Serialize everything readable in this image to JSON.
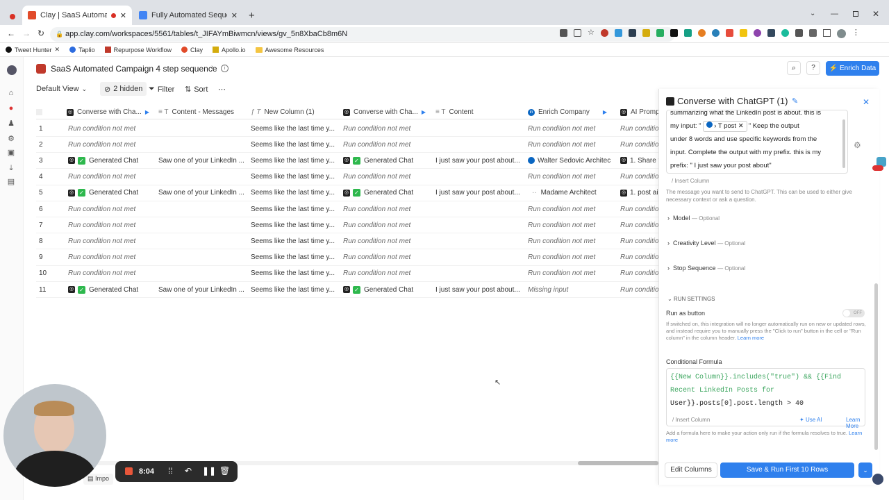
{
  "browser": {
    "tabs": [
      {
        "title": "Clay | SaaS Automated Camp"
      },
      {
        "title": "Fully Automated Sequences SaaS"
      }
    ],
    "url": "app.clay.com/workspaces/5561/tables/t_JIFAYmBiwmcn/views/gv_5n8XbaCb8m6N",
    "bookmarks": [
      "Tweet Hunter",
      "Taplio",
      "Repurpose Workflow",
      "Clay",
      "Apollo.io",
      "Awesome Resources"
    ]
  },
  "header": {
    "title": "SaaS Automated Campaign 4 step sequence",
    "enrich_label": "Enrich Data"
  },
  "toolbar": {
    "view": "Default View",
    "hidden": "2 hidden",
    "filter": "Filter",
    "sort": "Sort"
  },
  "columns": [
    "Converse with Cha...",
    "Content - Messages",
    "New Column (1)",
    "Converse with Cha...",
    "Content",
    "Enrich Company",
    "AI Promp"
  ],
  "rows": [
    [
      "1",
      "Run condition not met",
      "",
      "Seems like the last time y...",
      "Run condition not met",
      "",
      "Run condition not met",
      "Run conditio"
    ],
    [
      "2",
      "Run condition not met",
      "",
      "Seems like the last time y...",
      "Run condition not met",
      "",
      "Run condition not met",
      "Run conditio"
    ],
    [
      "3",
      "Generated Chat",
      "Saw one of your LinkedIn ...",
      "Seems like the last time y...",
      "Generated Chat",
      "I just saw your post about...",
      "Walter Sedovic Architec",
      "1. Share t"
    ],
    [
      "4",
      "Run condition not met",
      "",
      "Seems like the last time y...",
      "Run condition not met",
      "",
      "Run condition not met",
      "Run conditio"
    ],
    [
      "5",
      "Generated Chat",
      "Saw one of your LinkedIn ...",
      "Seems like the last time y...",
      "Generated Chat",
      "I just saw your post about...",
      "Madame Architect",
      "1. post ai"
    ],
    [
      "6",
      "Run condition not met",
      "",
      "Seems like the last time y...",
      "Run condition not met",
      "",
      "Run condition not met",
      "Run conditio"
    ],
    [
      "7",
      "Run condition not met",
      "",
      "Seems like the last time y...",
      "Run condition not met",
      "",
      "Run condition not met",
      "Run conditio"
    ],
    [
      "8",
      "Run condition not met",
      "",
      "Seems like the last time y...",
      "Run condition not met",
      "",
      "Run condition not met",
      "Run conditio"
    ],
    [
      "9",
      "Run condition not met",
      "",
      "Seems like the last time y...",
      "Run condition not met",
      "",
      "Run condition not met",
      "Run conditio"
    ],
    [
      "10",
      "Run condition not met",
      "",
      "Seems like the last time y...",
      "Run condition not met",
      "",
      "Run condition not met",
      "Run conditio"
    ],
    [
      "11",
      "Generated Chat",
      "Saw one of your LinkedIn ...",
      "Seems like the last time y...",
      "Generated Chat",
      "I just saw your post about...",
      "Missing input",
      "Run conditio"
    ]
  ],
  "panel": {
    "title": "Converse with ChatGPT (1)",
    "prompt_line1": "summarizing what the LinkedIn post is about. this is",
    "prompt_line2a": "my input: \"",
    "prompt_token": "post",
    "prompt_line2b": "\" Keep the output",
    "prompt_line3": "under 8 words and use specific keywords from the",
    "prompt_line4": "input. Complete the output with my prefix. this is my",
    "prompt_line5": "prefix: \" I just saw your post about\"",
    "insert_column": "Insert Column",
    "message_help": "The message you want to send to ChatGPT. This can be used to either give necessary context or ask a question.",
    "model": "Model",
    "creativity": "Creativity Level",
    "stop": "Stop Sequence",
    "optional": "— Optional",
    "run_settings": "RUN SETTINGS",
    "run_as_button": "Run as button",
    "toggle_off": "OFF",
    "run_help": "If switched on, this integration will no longer automatically run on new or updated rows, and instead require you to manually press the \"Click to run\" button in the cell or \"Run column\" in the column header.",
    "learn_more": "Learn more",
    "cond_label": "Conditional Formula",
    "formula1": "{{New Column}}.includes(\"true\") && {{Find",
    "formula2": "Recent LinkedIn Posts for",
    "formula3": "User}}.posts[0].post.length > 40",
    "use_ai": "Use AI",
    "learn_more2": "Learn More",
    "formula_help": "Add a formula here to make your action only run if the formula resolves to true.",
    "edit_columns": "Edit Columns",
    "save_run": "Save & Run First 10 Rows"
  },
  "recorder": {
    "time": "8:04"
  },
  "footer": {
    "import": "Impo"
  }
}
